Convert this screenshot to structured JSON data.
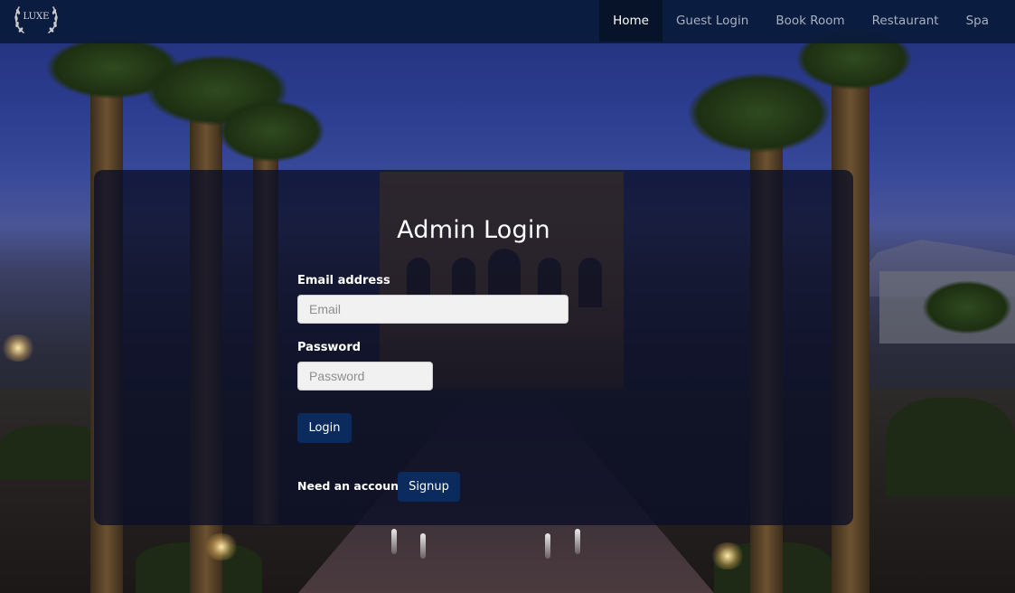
{
  "brand": {
    "logo_text": "LUXE"
  },
  "nav": {
    "items": [
      {
        "label": "Home",
        "active": true
      },
      {
        "label": "Guest Login",
        "active": false
      },
      {
        "label": "Book Room",
        "active": false
      },
      {
        "label": "Restaurant",
        "active": false
      },
      {
        "label": "Spa",
        "active": false
      }
    ]
  },
  "login": {
    "title": "Admin Login",
    "email_label": "Email address",
    "email_placeholder": "Email",
    "email_value": "",
    "password_label": "Password",
    "password_placeholder": "Password",
    "password_value": "",
    "login_button": "Login",
    "signup_prompt": "Need an account?",
    "signup_button": "Signup"
  },
  "colors": {
    "navbar": "#0a1a3c",
    "nav_active": "#061328",
    "button": "#0b2a5e",
    "panel": "#0a0e26"
  }
}
